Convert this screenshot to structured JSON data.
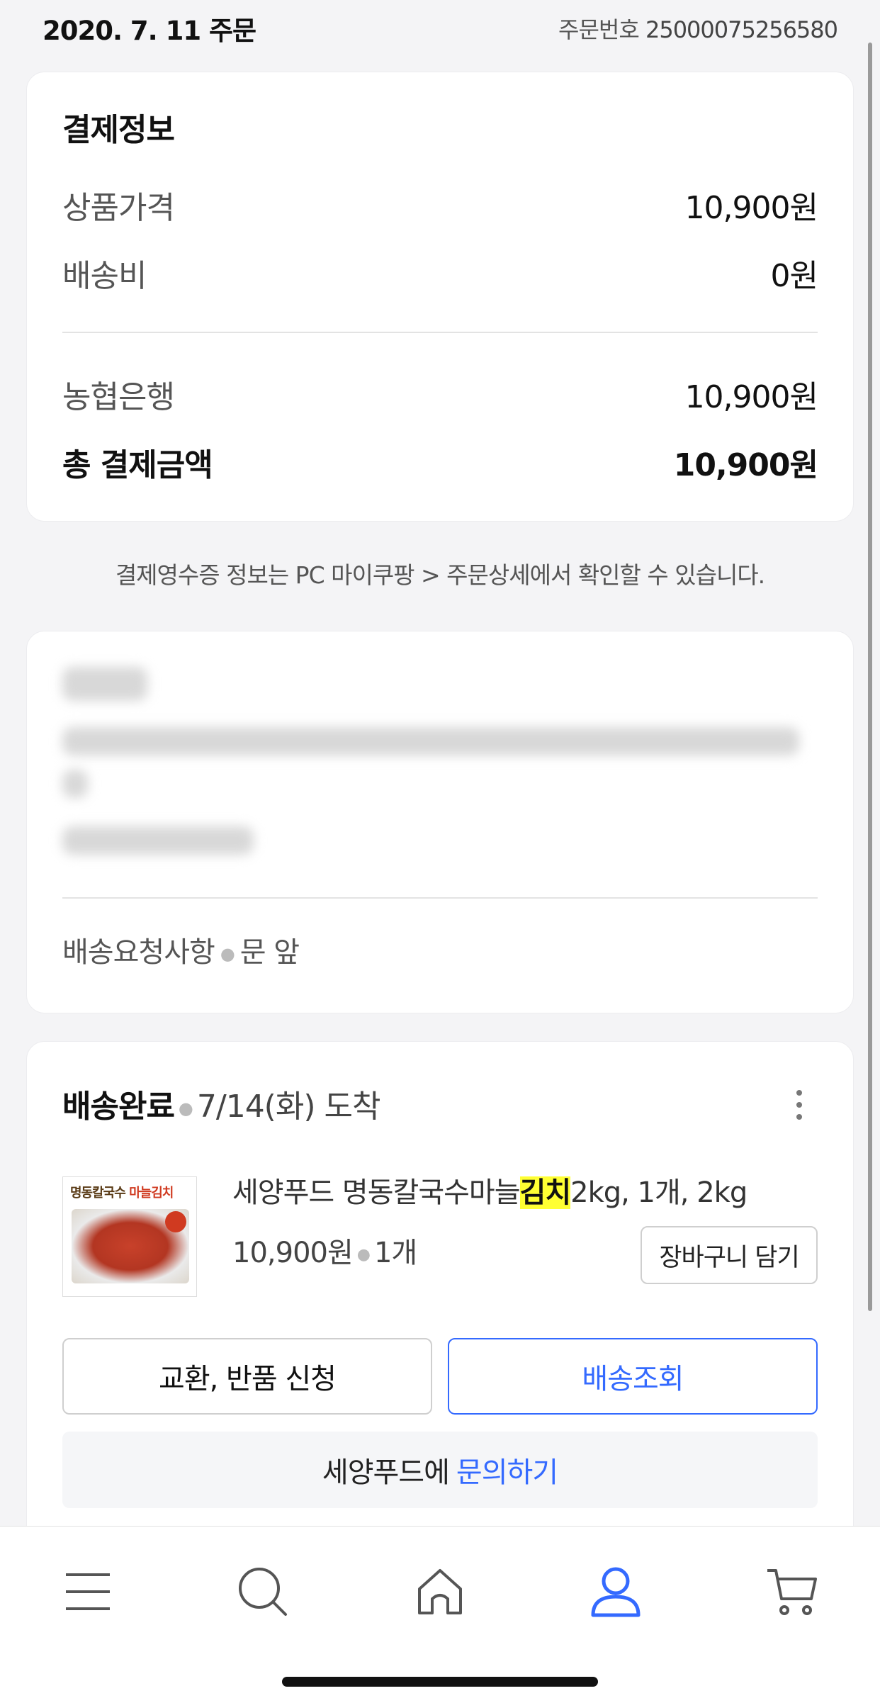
{
  "header": {
    "order_date": "2020. 7. 11 주문",
    "order_no_label": "주문번호",
    "order_no": "25000075256580"
  },
  "payment": {
    "title": "결제정보",
    "rows": [
      {
        "label": "상품가격",
        "value": "10,900원"
      },
      {
        "label": "배송비",
        "value": "0원"
      }
    ],
    "method": {
      "label": "농협은행",
      "value": "10,900원"
    },
    "total": {
      "label": "총 결제금액",
      "value": "10,900원"
    }
  },
  "receipt_note": "결제영수증 정보는 PC 마이쿠팡 > 주문상세에서 확인할 수 있습니다.",
  "address": {
    "request_label": "배송요청사항",
    "request_value": "문 앞"
  },
  "delivery": {
    "status": "배송완료",
    "arrival": "7/14(화) 도착",
    "thumb_text_a": "명동칼국수",
    "thumb_text_b": "마늘김치",
    "product_name_before": "세양푸드 명동칼국수마늘",
    "product_name_highlight": "김치",
    "product_name_after": "2kg, 1개, 2kg",
    "price": "10,900원",
    "qty": "1개",
    "cart_button": "장바구니 담기",
    "return_button": "교환, 반품 신청",
    "track_button": "배송조회",
    "inquiry_seller": "세양푸드에",
    "inquiry_link": "문의하기"
  },
  "nav": {
    "items": [
      {
        "icon": "menu-icon"
      },
      {
        "icon": "search-icon"
      },
      {
        "icon": "home-icon"
      },
      {
        "icon": "user-icon",
        "active": true
      },
      {
        "icon": "cart-icon"
      }
    ],
    "active_color": "#346aff",
    "inactive_color": "#555555"
  }
}
